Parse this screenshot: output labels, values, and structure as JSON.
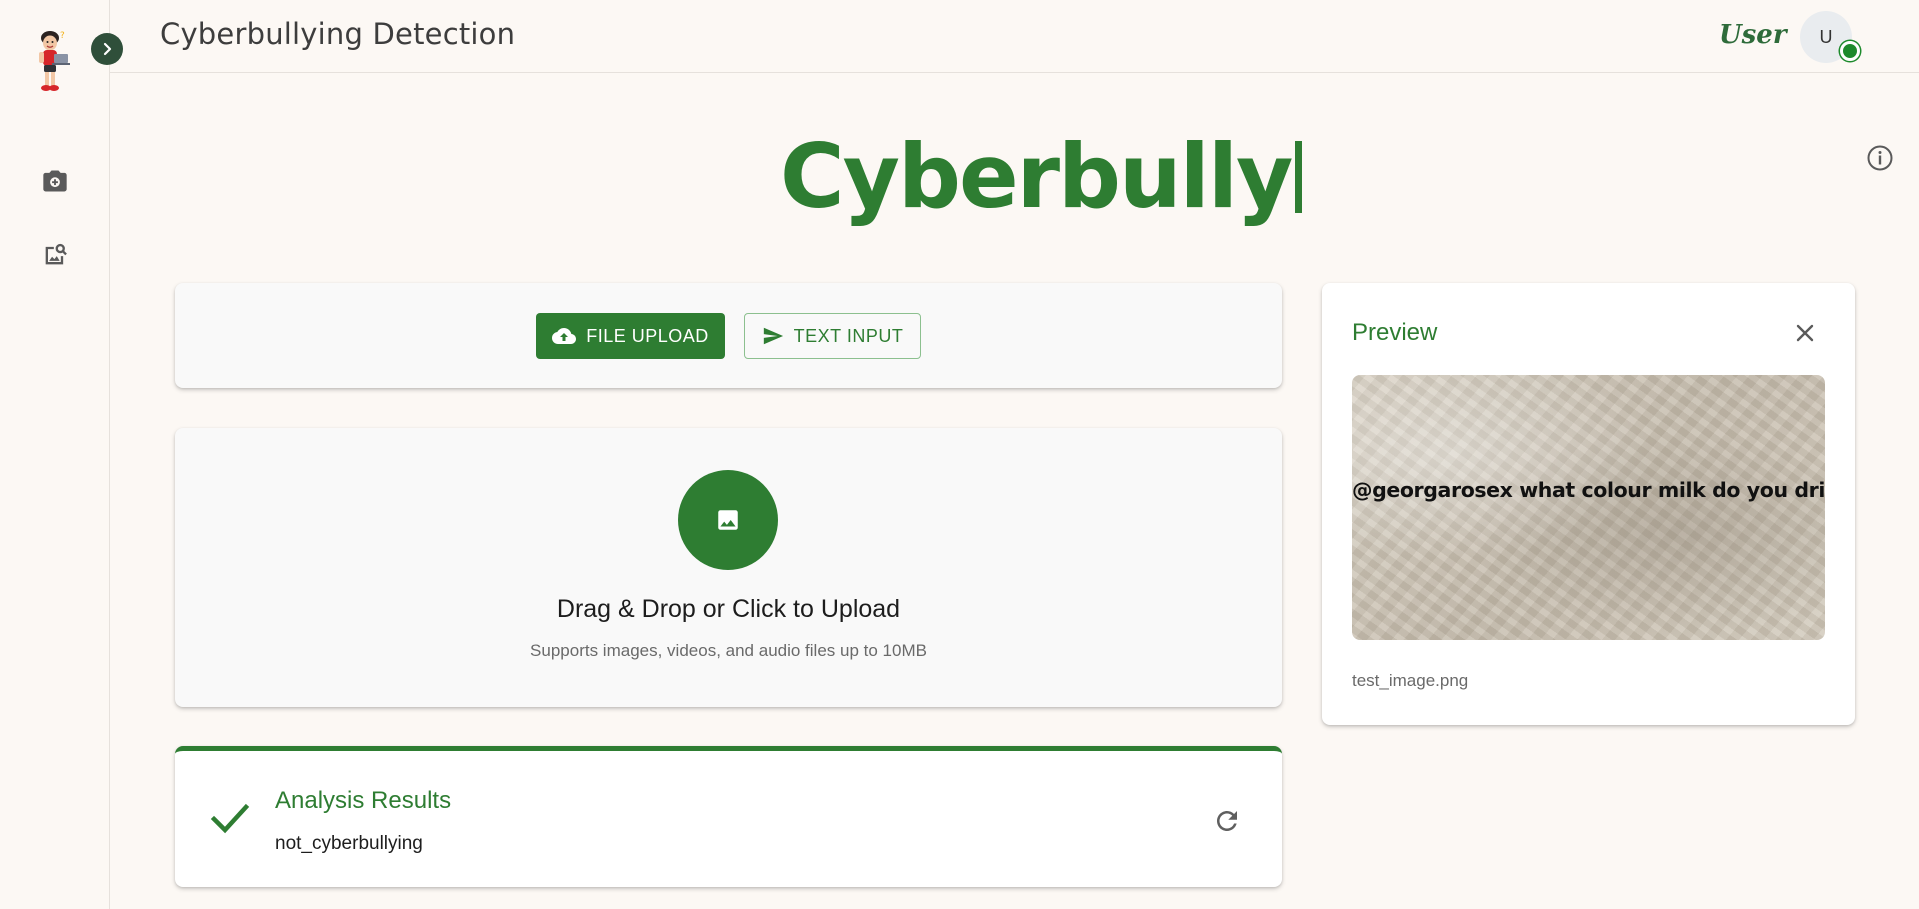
{
  "header": {
    "title": "Cyberbullying Detection",
    "user_label": "User",
    "avatar_initial": "U"
  },
  "sidebar": {
    "items": [
      {
        "icon": "add-photo-icon"
      },
      {
        "icon": "image-search-icon"
      }
    ]
  },
  "hero": {
    "text": "Cyberbully"
  },
  "mode_tabs": {
    "file_upload_label": "FILE UPLOAD",
    "text_input_label": "TEXT INPUT",
    "active": "file_upload"
  },
  "dropzone": {
    "title": "Drag & Drop or Click to Upload",
    "subtitle": "Supports images, videos, and audio files up to 10MB"
  },
  "results": {
    "title": "Analysis Results",
    "value": "not_cyberbullying"
  },
  "preview": {
    "title": "Preview",
    "image_text": "@georgarosex what colour milk do you drink?",
    "filename": "test_image.png"
  },
  "colors": {
    "accent": "#2e7d32",
    "background": "#fcf8f4",
    "online": "#1d8a2c"
  }
}
